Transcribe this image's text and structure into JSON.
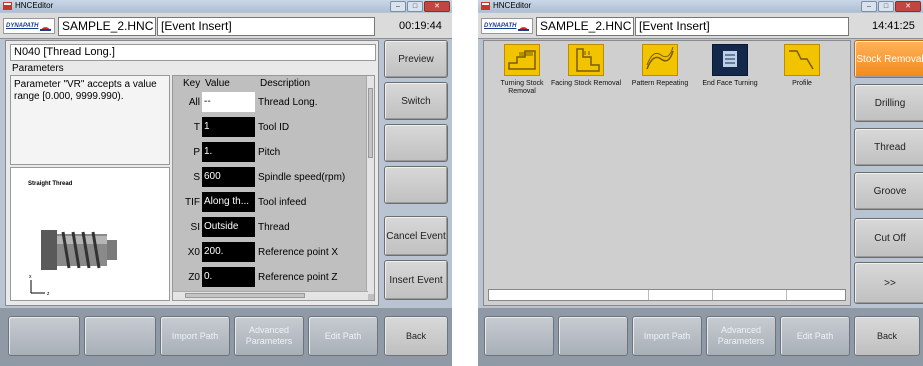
{
  "left": {
    "titlebar": {
      "title": "HNCEditor"
    },
    "header": {
      "file": "SAMPLE_2.HNC",
      "mode": "[Event Insert]",
      "time": "00:19:44",
      "logo": "DYNAPATH"
    },
    "block_header": "N040 [Thread Long.]",
    "parameters_label": "Parameters",
    "hint": "Parameter \"VR\" accepts a value range [0.000, 9999.990).",
    "image_title": "Straight Thread",
    "table": {
      "headers": {
        "key": "Key",
        "value": "Value",
        "desc": "Description"
      },
      "rows": [
        {
          "key": "All",
          "value": "--",
          "desc": "Thread Long."
        },
        {
          "key": "T",
          "value": "1",
          "desc": "Tool ID"
        },
        {
          "key": "P",
          "value": "1.",
          "desc": "Pitch"
        },
        {
          "key": "S",
          "value": "600",
          "desc": "Spindle speed(rpm)"
        },
        {
          "key": "TIF",
          "value": "Along th...",
          "desc": "Tool infeed"
        },
        {
          "key": "SI",
          "value": "Outside",
          "desc": "Thread"
        },
        {
          "key": "X0",
          "value": "200.",
          "desc": "Reference point X"
        },
        {
          "key": "Z0",
          "value": "0.",
          "desc": "Reference point Z"
        }
      ]
    },
    "side_buttons": {
      "preview": "Preview",
      "switch": "Switch",
      "blank1": "",
      "blank2": "",
      "cancel": "Cancel Event",
      "insert": "Insert Event"
    },
    "bottom_buttons": {
      "b1": "",
      "b2": "",
      "import": "Import Path",
      "advanced": "Advanced Parameters",
      "edit": "Edit Path",
      "back": "Back"
    }
  },
  "right": {
    "titlebar": {
      "title": "HNCEditor"
    },
    "header": {
      "file": "SAMPLE_2.HNC",
      "mode": "[Event Insert]",
      "time": "14:41:25",
      "logo": "DYNAPATH"
    },
    "cycles": [
      {
        "label": "Turning Stock Removal",
        "icon": "turning-stock-removal-icon"
      },
      {
        "label": "Facing Stock Removal",
        "icon": "facing-stock-removal-icon"
      },
      {
        "label": "Pattern Repeating",
        "icon": "pattern-repeating-icon"
      },
      {
        "label": "End Face Turning",
        "icon": "end-face-turning-icon"
      },
      {
        "label": "Profile",
        "icon": "profile-icon"
      }
    ],
    "side_buttons": {
      "stock": "Stock Removal",
      "drilling": "Drilling",
      "thread": "Thread",
      "groove": "Groove",
      "cutoff": "Cut Off",
      "more": ">>"
    },
    "bottom_buttons": {
      "b1": "",
      "b2": "",
      "import": "Import Path",
      "advanced": "Advanced Parameters",
      "edit": "Edit Path",
      "back": "Back"
    }
  },
  "colors": {
    "accent": "#f28a1c",
    "icon_yellow": "#f2c400",
    "icon_dark": "#13284a"
  }
}
